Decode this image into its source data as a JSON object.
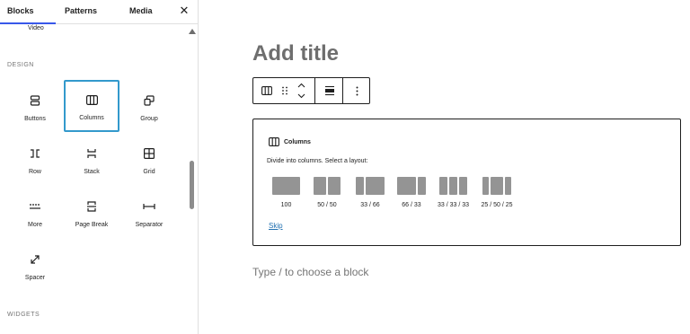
{
  "inserter": {
    "tabs": [
      {
        "label": "Blocks",
        "active": true
      },
      {
        "label": "Patterns",
        "active": false
      },
      {
        "label": "Media",
        "active": false
      }
    ],
    "close_icon": "close-icon",
    "top_partial_label": "Video",
    "sections": {
      "design": "DESIGN",
      "widgets": "WIDGETS"
    },
    "blocks": [
      {
        "label": "Buttons",
        "icon": "buttons-icon",
        "selected": false
      },
      {
        "label": "Columns",
        "icon": "columns-icon",
        "selected": true
      },
      {
        "label": "Group",
        "icon": "group-icon",
        "selected": false
      },
      {
        "label": "Row",
        "icon": "row-icon",
        "selected": false
      },
      {
        "label": "Stack",
        "icon": "stack-icon",
        "selected": false
      },
      {
        "label": "Grid",
        "icon": "grid-icon",
        "selected": false
      },
      {
        "label": "More",
        "icon": "more-icon",
        "selected": false
      },
      {
        "label": "Page Break",
        "icon": "page-break-icon",
        "selected": false
      },
      {
        "label": "Separator",
        "icon": "separator-icon",
        "selected": false
      },
      {
        "label": "Spacer",
        "icon": "spacer-icon",
        "selected": false
      }
    ]
  },
  "editor": {
    "title_placeholder": "Add title",
    "toolbar": {
      "items": [
        "columns-icon",
        "drag-handle-icon",
        "move-up-icon",
        "move-down-icon",
        "align-icon",
        "more-options-icon"
      ]
    },
    "columns_placeholder": {
      "title": "Columns",
      "instructions": "Divide into columns. Select a layout:",
      "variations": [
        {
          "label": "100",
          "ratios": [
            100
          ]
        },
        {
          "label": "50 / 50",
          "ratios": [
            50,
            50
          ]
        },
        {
          "label": "33 / 66",
          "ratios": [
            33,
            66
          ]
        },
        {
          "label": "66 / 33",
          "ratios": [
            66,
            33
          ]
        },
        {
          "label": "33 / 33 / 33",
          "ratios": [
            33,
            33,
            33
          ]
        },
        {
          "label": "25 / 50 / 25",
          "ratios": [
            25,
            50,
            25
          ]
        }
      ],
      "skip_label": "Skip"
    },
    "block_appender_placeholder": "Type / to choose a block"
  },
  "colors": {
    "accent": "#3858e9",
    "selection": "#3399cc",
    "link": "#2271b1",
    "variation_fill": "#949494"
  }
}
